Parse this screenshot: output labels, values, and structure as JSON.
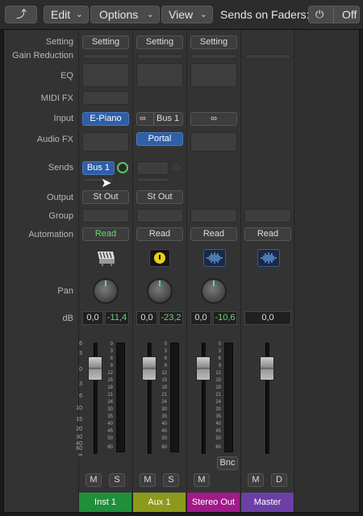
{
  "toolbar": {
    "back_glyph": "⤴",
    "edit_label": "Edit",
    "options_label": "Options",
    "view_label": "View",
    "sends_on_faders_label": "Sends on Faders:",
    "power_glyph": "⏻",
    "off_label": "Off"
  },
  "row_labels": {
    "setting": "Setting",
    "gain_reduction": "Gain Reduction",
    "eq": "EQ",
    "midi_fx": "MIDI FX",
    "input": "Input",
    "audio_fx": "Audio FX",
    "sends": "Sends",
    "output": "Output",
    "group": "Group",
    "automation": "Automation",
    "pan": "Pan",
    "db": "dB"
  },
  "strips": {
    "inst1": {
      "setting": "Setting",
      "input": "E-Piano",
      "send": "Bus 1",
      "output": "St Out",
      "automation": "Read",
      "db_value": "0,0",
      "db_peak": "-11,4",
      "mute": "M",
      "solo": "S",
      "name": "Inst 1",
      "color": "#1f8f3a",
      "icon": "keyboard-icon"
    },
    "aux1": {
      "setting": "Setting",
      "input_link_glyph": "∞",
      "input": "Bus 1",
      "audio_fx": "Portal",
      "output": "St Out",
      "automation": "Read",
      "db_value": "0,0",
      "db_peak": "-23,2",
      "mute": "M",
      "solo": "S",
      "name": "Aux 1",
      "color": "#8c9a1c",
      "icon": "aux-icon"
    },
    "stereo_out": {
      "setting": "Setting",
      "input_link_glyph": "∞",
      "automation": "Read",
      "db_value": "0,0",
      "db_peak": "-10,6",
      "bnc_label": "Bnc",
      "mute": "M",
      "name": "Stereo Out",
      "color": "#a11a8a",
      "icon": "waveform-icon"
    },
    "master": {
      "automation": "Read",
      "db_value": "0,0",
      "mute": "M",
      "dim": "D",
      "name": "Master",
      "color": "#6b3fa6",
      "icon": "waveform-icon"
    }
  },
  "meter_scale": [
    "6",
    "3",
    "0",
    "3",
    "6",
    "10",
    "15",
    "20",
    "30",
    "40",
    "60",
    "∞"
  ],
  "meter_scale_right": [
    "0",
    "3",
    "6",
    "9",
    "12",
    "15",
    "18",
    "21",
    "24",
    "30",
    "35",
    "40",
    "45",
    "50",
    "60"
  ]
}
